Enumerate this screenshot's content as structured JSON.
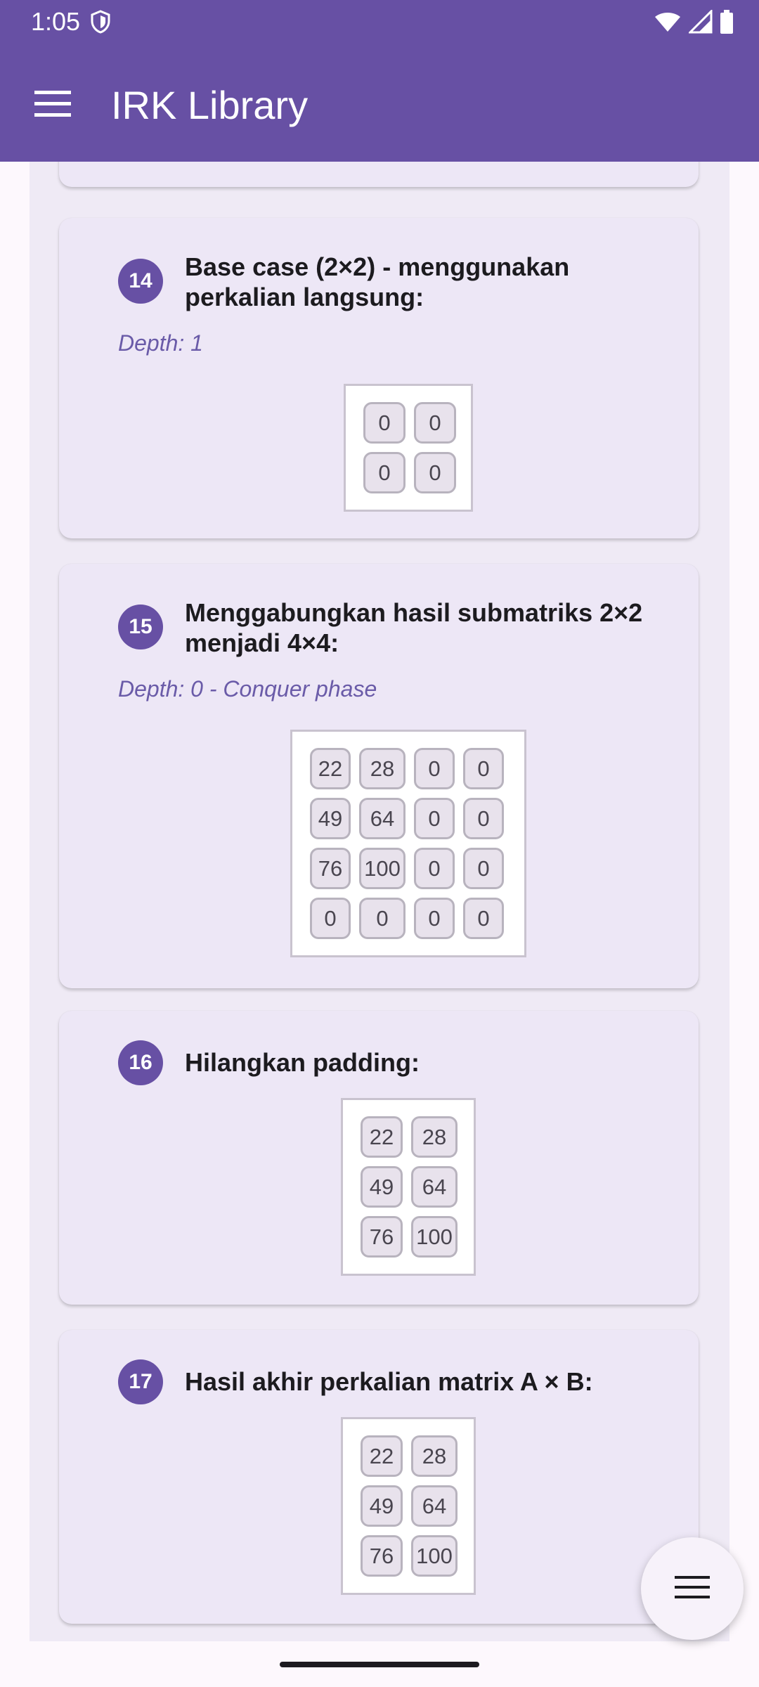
{
  "status_bar": {
    "time": "1:05"
  },
  "app_bar": {
    "title": "IRK Library"
  },
  "steps": [
    {
      "number": "14",
      "title": "Base case (2×2) - menggunakan perkalian langsung:",
      "depth": "Depth: 1",
      "matrix": [
        [
          "0",
          "0"
        ],
        [
          "0",
          "0"
        ]
      ]
    },
    {
      "number": "15",
      "title": "Menggabungkan hasil submatriks 2×2 menjadi 4×4:",
      "depth": "Depth: 0 - Conquer phase",
      "matrix": [
        [
          "22",
          "28",
          "0",
          "0"
        ],
        [
          "49",
          "64",
          "0",
          "0"
        ],
        [
          "76",
          "100",
          "0",
          "0"
        ],
        [
          "0",
          "0",
          "0",
          "0"
        ]
      ]
    },
    {
      "number": "16",
      "title": "Hilangkan padding:",
      "matrix": [
        [
          "22",
          "28"
        ],
        [
          "49",
          "64"
        ],
        [
          "76",
          "100"
        ]
      ]
    },
    {
      "number": "17",
      "title": "Hasil akhir perkalian matrix A × B:",
      "matrix": [
        [
          "22",
          "28"
        ],
        [
          "49",
          "64"
        ],
        [
          "76",
          "100"
        ]
      ]
    }
  ],
  "colors": {
    "primary": "#6750a4",
    "card": "#ede7f6",
    "depth_text": "#6a5ba8"
  },
  "icons": {
    "menu": "hamburger-menu-icon",
    "fab": "menu-lines-icon",
    "status": [
      "shield-icon",
      "wifi-icon",
      "signal-icon",
      "battery-icon"
    ]
  }
}
